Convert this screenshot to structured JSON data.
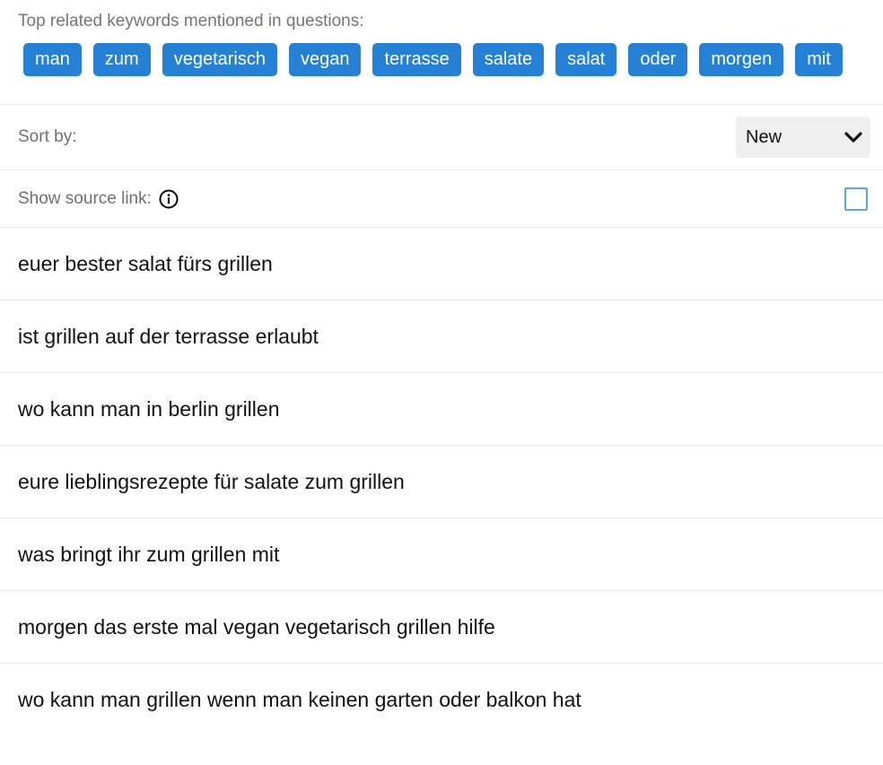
{
  "keywords": {
    "title": "Top related keywords mentioned in questions:",
    "chips": [
      "man",
      "zum",
      "vegetarisch",
      "vegan",
      "terrasse",
      "salate",
      "salat",
      "oder",
      "morgen",
      "mit"
    ],
    "chip_color": "#2680d4"
  },
  "sort": {
    "label": "Sort by:",
    "selected": "New",
    "icon": "chevron-down-icon"
  },
  "source_link": {
    "label": "Show source link:",
    "icon": "info-icon",
    "checked": false
  },
  "questions": [
    "euer bester salat fürs grillen",
    "ist grillen auf der terrasse erlaubt",
    "wo kann man in berlin grillen",
    "eure lieblingsrezepte für salate zum grillen",
    "was bringt ihr zum grillen mit",
    "morgen das erste mal vegan vegetarisch grillen hilfe",
    "wo kann man grillen wenn man keinen garten oder balkon hat"
  ]
}
